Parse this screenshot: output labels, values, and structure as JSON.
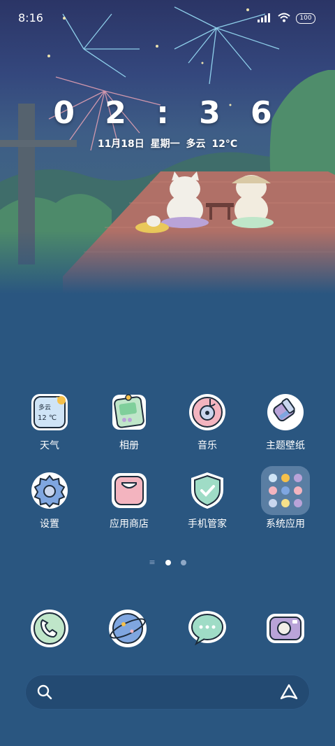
{
  "status_bar": {
    "time": "8:16",
    "battery": "100",
    "signal_icon": "signal-icon",
    "wifi_icon": "wifi-icon"
  },
  "lockclock": {
    "digits": "0 2 : 3 6",
    "date": "11月18日  星期一  多云  12°C"
  },
  "apps": [
    {
      "label": "天气",
      "icon": "weather-icon",
      "widget_text": "多云",
      "widget_temp": "12 ℃"
    },
    {
      "label": "相册",
      "icon": "gallery-icon"
    },
    {
      "label": "音乐",
      "icon": "music-icon"
    },
    {
      "label": "主题壁纸",
      "icon": "theme-icon"
    },
    {
      "label": "设置",
      "icon": "settings-icon"
    },
    {
      "label": "应用商店",
      "icon": "app-store-icon"
    },
    {
      "label": "手机管家",
      "icon": "security-icon"
    },
    {
      "label": "系统应用",
      "icon": "system-apps-folder-icon"
    }
  ],
  "pager": {
    "pages": 3,
    "current": 1
  },
  "dock": [
    {
      "icon": "phone-icon"
    },
    {
      "icon": "browser-icon"
    },
    {
      "icon": "messages-icon"
    },
    {
      "icon": "camera-icon"
    }
  ],
  "colors": {
    "background": "#2a5680",
    "accent_green": "#bfe6c9",
    "accent_pink": "#f3b4bf",
    "accent_blue": "#7fa6e0"
  }
}
